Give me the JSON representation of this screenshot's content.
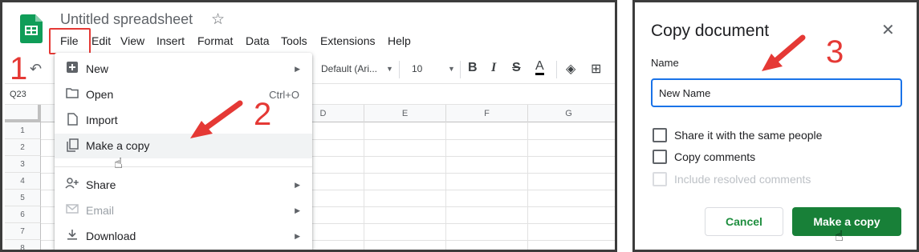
{
  "colors": {
    "accent_red": "#e53935",
    "sheets_green": "#188038",
    "focus_blue": "#1a73e8"
  },
  "sheets": {
    "title": "Untitled spreadsheet",
    "menu": [
      "File",
      "Edit",
      "View",
      "Insert",
      "Format",
      "Data",
      "Tools",
      "Extensions",
      "Help"
    ],
    "toolbar": {
      "font": "Default (Ari...",
      "font_size": "10"
    },
    "name_box": "Q23",
    "columns": [
      "D",
      "E",
      "F",
      "G"
    ],
    "rows": [
      "1",
      "2",
      "3",
      "4",
      "5",
      "6",
      "7",
      "8"
    ],
    "file_menu": {
      "items": [
        {
          "label": "New",
          "icon": "plus-icon",
          "submenu": true,
          "shortcut": "",
          "disabled": false
        },
        {
          "label": "Open",
          "icon": "folder-icon",
          "submenu": false,
          "shortcut": "Ctrl+O",
          "disabled": false
        },
        {
          "label": "Import",
          "icon": "file-icon",
          "submenu": false,
          "shortcut": "",
          "disabled": false
        },
        {
          "label": "Make a copy",
          "icon": "copy-icon",
          "submenu": false,
          "shortcut": "",
          "disabled": false
        },
        {
          "label": "Share",
          "icon": "person-add-icon",
          "submenu": true,
          "shortcut": "",
          "disabled": false
        },
        {
          "label": "Email",
          "icon": "mail-icon",
          "submenu": true,
          "shortcut": "",
          "disabled": true
        },
        {
          "label": "Download",
          "icon": "download-icon",
          "submenu": true,
          "shortcut": "",
          "disabled": false
        }
      ]
    }
  },
  "annotations": {
    "step1": "1",
    "step2": "2",
    "step3": "3"
  },
  "dialog": {
    "title": "Copy document",
    "name_label": "Name",
    "name_value": "New Name",
    "checkboxes": [
      {
        "label": "Share it with the same people",
        "checked": false,
        "disabled": false
      },
      {
        "label": "Copy comments",
        "checked": false,
        "disabled": false
      },
      {
        "label": "Include resolved comments",
        "checked": false,
        "disabled": true
      }
    ],
    "cancel_label": "Cancel",
    "confirm_label": "Make a copy"
  }
}
